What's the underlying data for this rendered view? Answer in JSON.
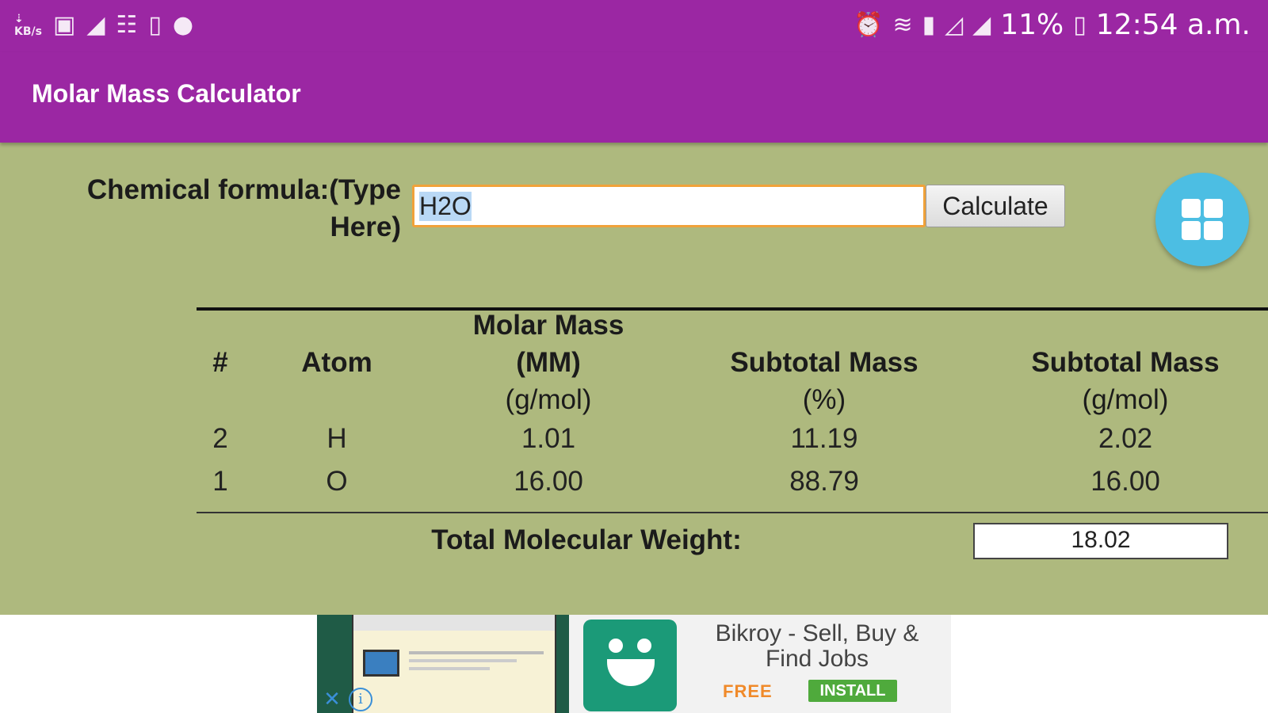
{
  "status_bar": {
    "net_speed": "1 KB/s",
    "battery_percent": "11%",
    "time": "12:54 a.m.",
    "left_icons": [
      "net-speed-icon",
      "image-icon",
      "cleaner-icon",
      "storage-icon",
      "device-icon",
      "chat-icon"
    ],
    "right_icons": [
      "alarm-icon",
      "wifi-icon",
      "sim-icon",
      "signal-icon",
      "signal-icon",
      "battery-icon"
    ]
  },
  "app_bar": {
    "title": "Molar Mass Calculator"
  },
  "formula": {
    "label_line1": "Chemical formula:(Type",
    "label_line2": "Here)",
    "value": "H2O",
    "calculate_label": "Calculate"
  },
  "table": {
    "headers": {
      "num": "#",
      "atom": "Atom",
      "mm_line1": "Molar Mass",
      "mm_line2": "(MM)",
      "mm_unit": "(g/mol)",
      "sub_pct_line1": "Subtotal Mass",
      "sub_pct_unit": "(%)",
      "sub_gmol_line1": "Subtotal Mass",
      "sub_gmol_unit": "(g/mol)"
    },
    "rows": [
      {
        "count": "2",
        "atom": "H",
        "molar_mass": "1.01",
        "subtotal_pct": "11.19",
        "subtotal_gmol": "2.02"
      },
      {
        "count": "1",
        "atom": "O",
        "molar_mass": "16.00",
        "subtotal_pct": "88.79",
        "subtotal_gmol": "16.00"
      }
    ]
  },
  "total": {
    "label": "Total Molecular Weight:",
    "value": "18.02"
  },
  "ad": {
    "title": "Bikroy - Sell, Buy & Find Jobs",
    "free_label": "FREE",
    "install_label": "INSTALL",
    "close_glyph": "✕",
    "info_glyph": "i"
  },
  "colors": {
    "app_bar": "#9b27a3",
    "content_bg": "#aeb97e",
    "input_border": "#f0a23a",
    "fab": "#4cbee3",
    "ad_logo": "#1b9a78",
    "install": "#4faa3c",
    "free": "#f08a2a"
  }
}
